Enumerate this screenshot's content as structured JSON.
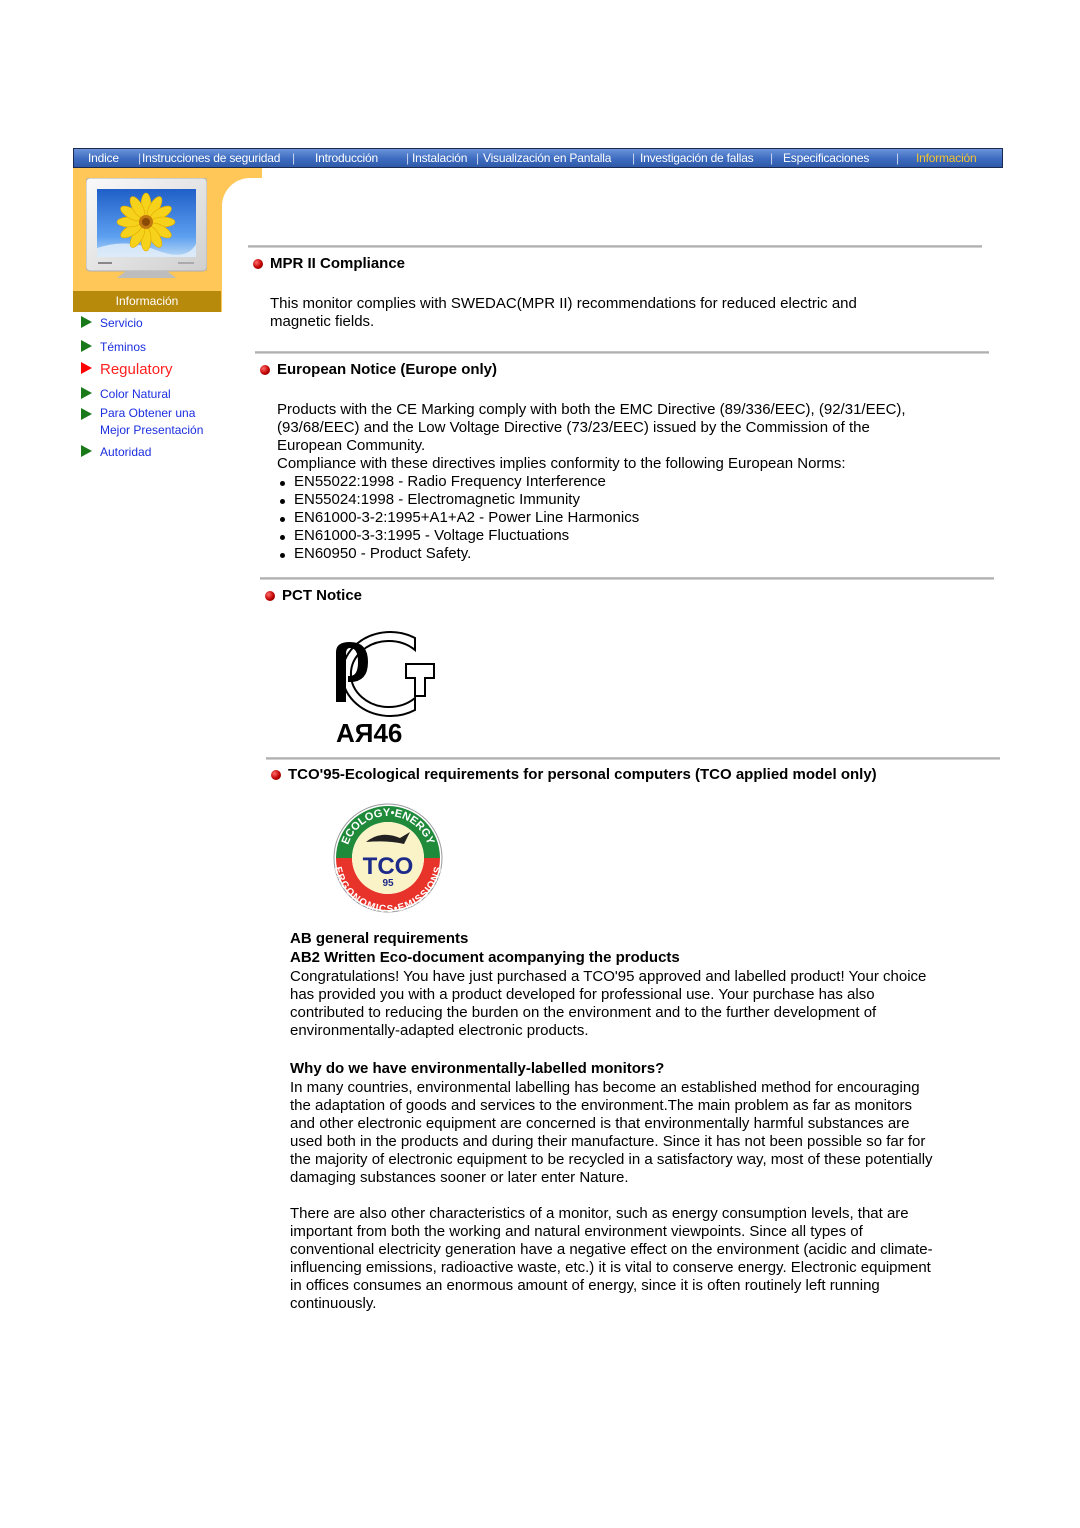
{
  "nav": {
    "items": [
      {
        "label": "Indice",
        "active": false
      },
      {
        "label": "Instrucciones de seguridad",
        "active": false
      },
      {
        "label": "Introducción",
        "active": false
      },
      {
        "label": "Instalación",
        "active": false
      },
      {
        "label": "Visualización en Pantalla",
        "active": false
      },
      {
        "label": "Investigación de fallas",
        "active": false
      },
      {
        "label": "Especificaciones",
        "active": false
      },
      {
        "label": "Información",
        "active": true
      }
    ],
    "separator": "|"
  },
  "header": {
    "section_label": "Información",
    "image": "monitor-with-sunflower"
  },
  "sidebar": {
    "items": [
      {
        "label": "Servicio",
        "icon": "triangle-right-icon",
        "active": false
      },
      {
        "label": "Téminos",
        "icon": "triangle-right-icon",
        "active": false
      },
      {
        "label": "Regulatory",
        "icon": "triangle-right-icon",
        "active": true
      },
      {
        "label": "Color Natural",
        "icon": "triangle-right-icon",
        "active": false
      },
      {
        "label": "Para Obtener una Mejor Presentación",
        "line1": "Para Obtener una",
        "line2": "Mejor Presentación",
        "icon": "triangle-right-icon",
        "active": false
      },
      {
        "label": "Autoridad",
        "icon": "triangle-right-icon",
        "active": false
      }
    ]
  },
  "content": {
    "mpr": {
      "title": "MPR II Compliance",
      "text_line1": "This monitor complies with SWEDAC(MPR II) recommendations for reduced electric and",
      "text_line2": "magnetic fields."
    },
    "european": {
      "title": "European Notice (Europe only)",
      "lines": [
        "Products with the CE Marking comply with both the EMC Directive (89/336/EEC), (92/31/EEC),",
        "(93/68/EEC) and the Low Voltage Directive (73/23/EEC) issued by the Commission of the",
        "European Community.",
        "Compliance with these directives implies conformity to the following European Norms:"
      ],
      "norms": [
        "EN55022:1998 - Radio Frequency Interference",
        "EN55024:1998 - Electromagnetic Immunity",
        "EN61000-3-2:1995+A1+A2 - Power Line Harmonics",
        "EN61000-3-3:1995 - Voltage Fluctuations",
        "EN60950 - Product Safety."
      ]
    },
    "pct": {
      "title": "PCT Notice",
      "logo_code": "АЯ46"
    },
    "tco": {
      "title": "TCO'95-Ecological requirements for personal computers (TCO applied model only)",
      "logo": {
        "top_text": "ECOLOGY•ENERGY",
        "bottom_text": "ERGONOMICS•EMISSIONS",
        "center_text": "TCO",
        "year": "95"
      },
      "ab_general": "AB general requirements",
      "ab2_title": "AB2 Written Eco-document acompanying the products",
      "ab2_lines": [
        "Congratulations! You have just purchased a TCO'95 approved and labelled product! Your choice",
        "has provided you with a product developed for professional use. Your purchase has also",
        "contributed to reducing the burden on the environment and to the further development of",
        "environmentally-adapted electronic products."
      ],
      "why_title": "Why do we have environmentally-labelled monitors?",
      "why_lines": [
        "In many countries, environmental labelling has become an established method for encouraging",
        "the adaptation of goods and services to the environment.The main problem as far as monitors",
        "and other electronic equipment are concerned is that environmentally harmful substances are",
        "used both in the products and during their manufacture. Since it has not been possible so far for",
        "the majority of electronic equipment to be recycled in a satisfactory way, most of these potentially",
        "damaging substances sooner or later enter Nature."
      ],
      "other_lines": [
        "There are also other characteristics of a monitor, such as energy consumption levels, that are",
        "important from both the working and natural environment viewpoints. Since all types of",
        "conventional electricity generation have a negative effect on the environment (acidic and climate-",
        "influencing emissions, radioactive waste, etc.) it is vital to conserve energy. Electronic equipment",
        "in offices consumes an enormous amount of energy, since it is often routinely left running",
        "continuously."
      ]
    }
  },
  "colors": {
    "nav_bg": "#3d6bc0",
    "nav_active": "#f4c430",
    "header_yellow": "#ffc658",
    "info_band": "#b88a0b",
    "link_blue": "#1a2ee0",
    "active_red": "#ff2020",
    "bullet_green": "#1a7a1a"
  }
}
